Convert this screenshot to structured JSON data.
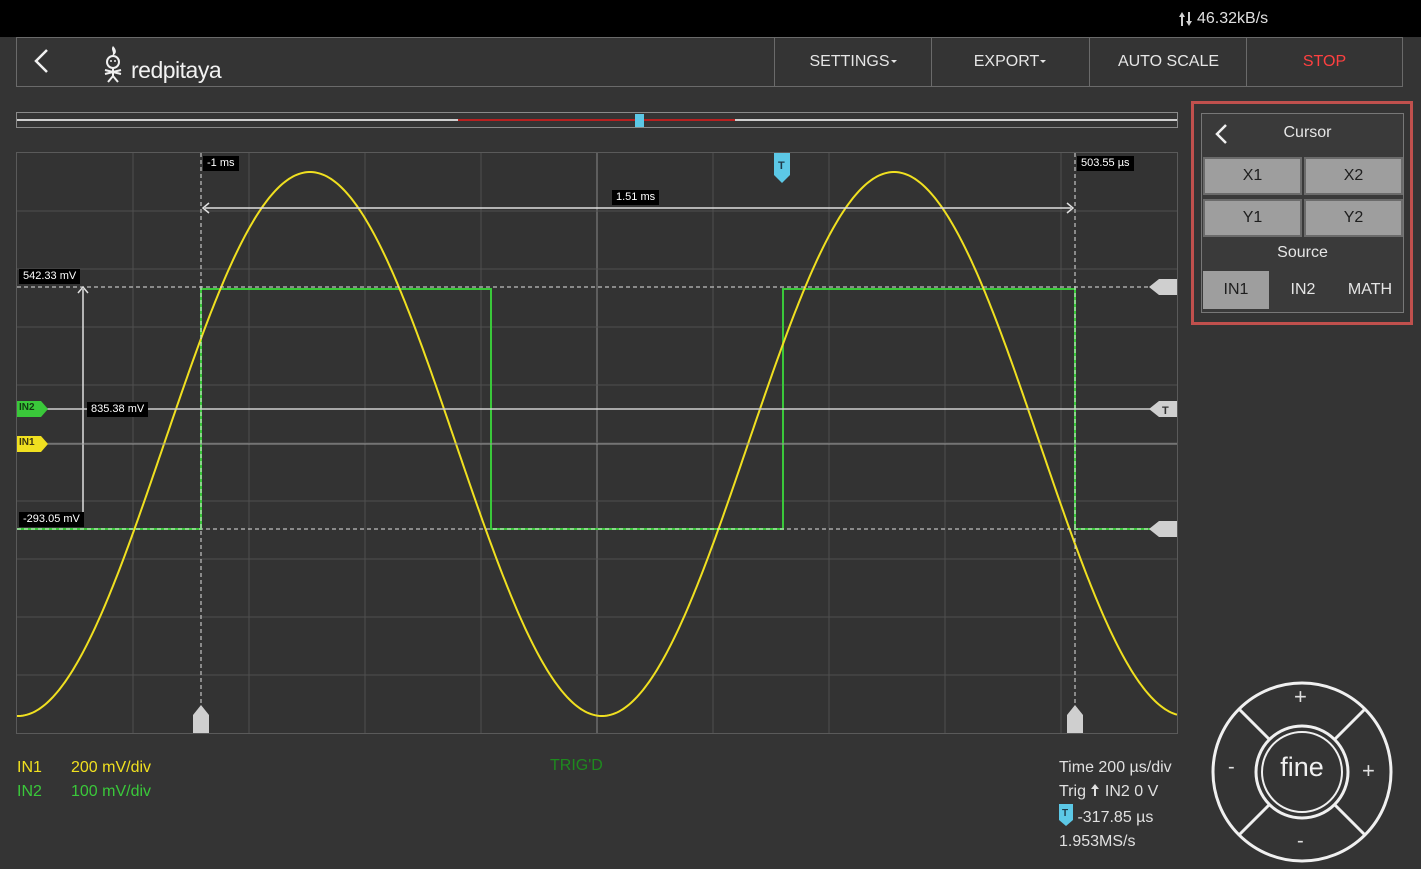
{
  "status_bar": {
    "data_rate": "46.32kB/s"
  },
  "header": {
    "logo_text": "redpitaya",
    "settings_label": "SETTINGS",
    "export_label": "EXPORT",
    "autoscale_label": "AUTO SCALE",
    "stop_label": "STOP"
  },
  "plot": {
    "cursor_x1_label": "-1 ms",
    "cursor_x2_label": "503.55 µs",
    "cursor_dx_label": "1.51 ms",
    "cursor_y1_label": "542.33 mV",
    "cursor_y2_label": "-293.05 mV",
    "cursor_dy_label": "835.38 mV",
    "in1_marker": "IN1",
    "in2_marker": "IN2",
    "trigger_marker": "T"
  },
  "cursor_panel": {
    "title": "Cursor",
    "x1": "X1",
    "x2": "X2",
    "y1": "Y1",
    "y2": "Y2",
    "source_title": "Source",
    "sources": [
      "IN1",
      "IN2",
      "MATH"
    ],
    "active_source": "IN1"
  },
  "channels": [
    {
      "name": "IN1",
      "scale": "200 mV/div",
      "color": "#f0e020"
    },
    {
      "name": "IN2",
      "scale": "100 mV/div",
      "color": "#3ac83a"
    }
  ],
  "trigger_status": "TRIG'D",
  "info": {
    "time": "Time 200 µs/div",
    "trig": "Trig",
    "trig_detail": "IN2 0 V",
    "trig_offset": "-317.85 µs",
    "sample_rate": "1.953MS/s"
  },
  "dial": {
    "center_label": "fine",
    "plus": "+",
    "minus": "-"
  }
}
